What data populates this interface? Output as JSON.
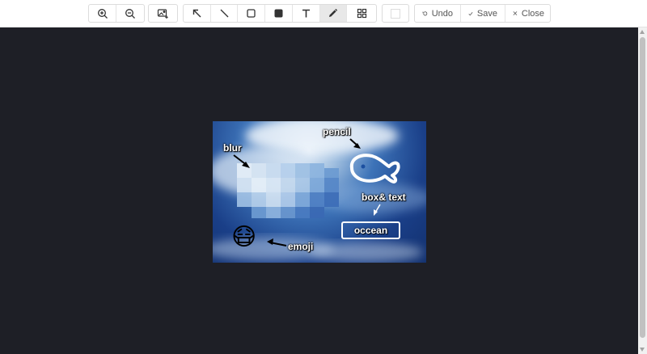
{
  "toolbar": {
    "zoom_in_icon": "zoom-in-icon",
    "zoom_out_icon": "zoom-out-icon",
    "fit_image_icon": "image-fit-icon",
    "tools": [
      "arrow-icon",
      "line-icon",
      "rectangle-icon",
      "fill-rectangle-icon",
      "text-icon",
      "pencil-icon",
      "grid-icon"
    ],
    "active_tool": "pencil-icon",
    "color_swatch": "#ffffff",
    "undo_label": "Undo",
    "save_label": "Save",
    "close_label": "Close"
  },
  "canvas": {
    "annotations": {
      "blur": "blur",
      "pencil": "pencil",
      "box_text": "box& text",
      "box_value": "occean",
      "emoji": "emoji",
      "emoji_symbol": "😷"
    }
  },
  "colors": {
    "workspace_bg": "#1e1f26",
    "toolbar_bg": "#ffffff",
    "annotation": "#ffffff"
  }
}
